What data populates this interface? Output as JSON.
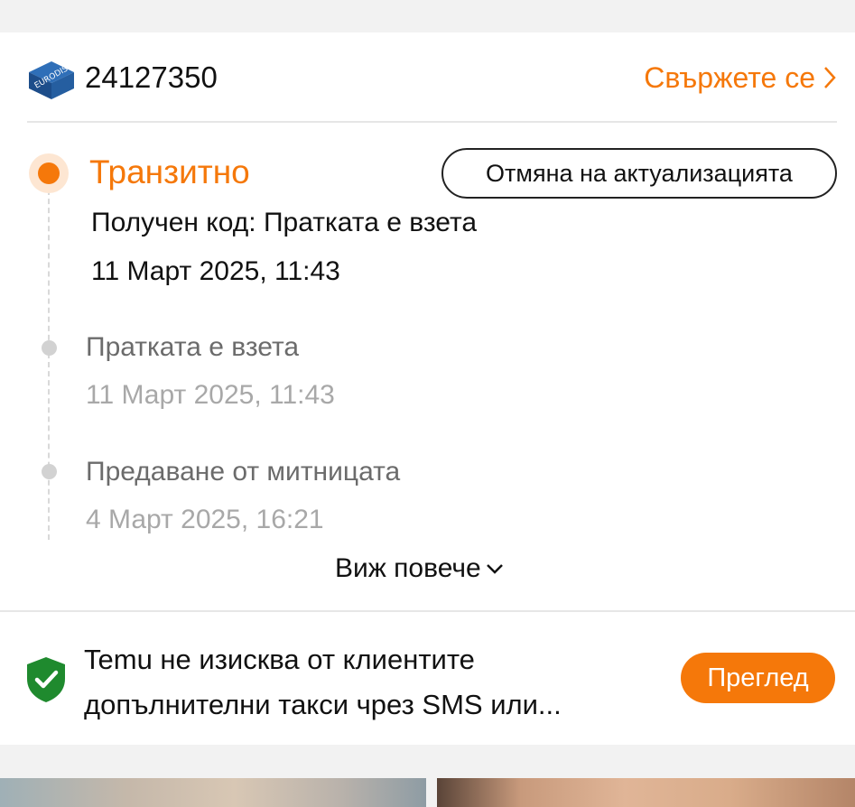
{
  "shipment": {
    "carrier_logo_text": "EURODIS",
    "tracking_number": "24127350",
    "contact_label": "Свържете се"
  },
  "timeline": {
    "current": {
      "status": "Транзитно",
      "description": "Получен код: Пратката е взета",
      "time": "11 Март 2025, 11:43",
      "cancel_label": "Отмяна на актуализацията"
    },
    "events": [
      {
        "title": "Пратката е взета",
        "time": "11 Март 2025, 11:43"
      },
      {
        "title": "Предаване от митницата",
        "time": "4 Март 2025, 16:21"
      }
    ],
    "see_more_label": "Виж повече"
  },
  "notice": {
    "text": "Temu не изисква от клиентите допълнителни такси чрез SMS или...",
    "button_label": "Преглед"
  },
  "colors": {
    "accent": "#f5780a",
    "shield": "#1f8a2e"
  }
}
